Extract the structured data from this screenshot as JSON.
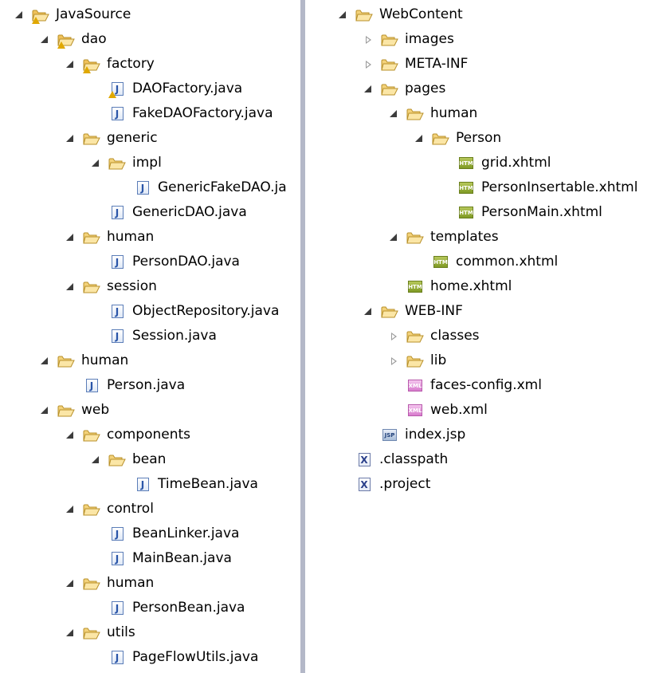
{
  "left_tree": [
    {
      "label": "JavaSource",
      "icon": "package-folder-warning-icon",
      "state": "expanded",
      "depth": 0
    },
    {
      "label": "dao",
      "icon": "package-folder-warning-icon",
      "state": "expanded",
      "depth": 1
    },
    {
      "label": "factory",
      "icon": "package-folder-warning-icon",
      "state": "expanded",
      "depth": 2
    },
    {
      "label": "DAOFactory.java",
      "icon": "java-file-warning-icon",
      "state": "leaf",
      "depth": 3
    },
    {
      "label": "FakeDAOFactory.java",
      "icon": "java-file-icon",
      "state": "leaf",
      "depth": 3
    },
    {
      "label": "generic",
      "icon": "folder-icon",
      "state": "expanded",
      "depth": 2
    },
    {
      "label": "impl",
      "icon": "folder-icon",
      "state": "expanded",
      "depth": 3
    },
    {
      "label": "GenericFakeDAO.ja",
      "icon": "java-file-icon",
      "state": "leaf",
      "depth": 4
    },
    {
      "label": "GenericDAO.java",
      "icon": "java-file-icon",
      "state": "leaf",
      "depth": 3
    },
    {
      "label": "human",
      "icon": "folder-icon",
      "state": "expanded",
      "depth": 2
    },
    {
      "label": "PersonDAO.java",
      "icon": "java-file-icon",
      "state": "leaf",
      "depth": 3
    },
    {
      "label": "session",
      "icon": "folder-icon",
      "state": "expanded",
      "depth": 2
    },
    {
      "label": "ObjectRepository.java",
      "icon": "java-file-icon",
      "state": "leaf",
      "depth": 3
    },
    {
      "label": "Session.java",
      "icon": "java-file-icon",
      "state": "leaf",
      "depth": 3
    },
    {
      "label": "human",
      "icon": "folder-icon",
      "state": "expanded",
      "depth": 1
    },
    {
      "label": "Person.java",
      "icon": "java-file-icon",
      "state": "leaf",
      "depth": 2
    },
    {
      "label": "web",
      "icon": "folder-icon",
      "state": "expanded",
      "depth": 1
    },
    {
      "label": "components",
      "icon": "folder-icon",
      "state": "expanded",
      "depth": 2
    },
    {
      "label": "bean",
      "icon": "folder-icon",
      "state": "expanded",
      "depth": 3
    },
    {
      "label": "TimeBean.java",
      "icon": "java-file-icon",
      "state": "leaf",
      "depth": 4
    },
    {
      "label": "control",
      "icon": "folder-icon",
      "state": "expanded",
      "depth": 2
    },
    {
      "label": "BeanLinker.java",
      "icon": "java-file-icon",
      "state": "leaf",
      "depth": 3
    },
    {
      "label": "MainBean.java",
      "icon": "java-file-icon",
      "state": "leaf",
      "depth": 3
    },
    {
      "label": "human",
      "icon": "folder-icon",
      "state": "expanded",
      "depth": 2
    },
    {
      "label": "PersonBean.java",
      "icon": "java-file-icon",
      "state": "leaf",
      "depth": 3
    },
    {
      "label": "utils",
      "icon": "folder-icon",
      "state": "expanded",
      "depth": 2
    },
    {
      "label": "PageFlowUtils.java",
      "icon": "java-file-icon",
      "state": "leaf",
      "depth": 3
    }
  ],
  "right_tree": [
    {
      "label": "WebContent",
      "icon": "folder-icon",
      "state": "expanded",
      "depth": 0
    },
    {
      "label": "images",
      "icon": "folder-icon",
      "state": "collapsed",
      "depth": 1
    },
    {
      "label": "META-INF",
      "icon": "folder-icon",
      "state": "collapsed",
      "depth": 1
    },
    {
      "label": "pages",
      "icon": "folder-icon",
      "state": "expanded",
      "depth": 1
    },
    {
      "label": "human",
      "icon": "folder-icon",
      "state": "expanded",
      "depth": 2
    },
    {
      "label": "Person",
      "icon": "folder-icon",
      "state": "expanded",
      "depth": 3
    },
    {
      "label": "grid.xhtml",
      "icon": "html-file-icon",
      "state": "leaf",
      "depth": 4
    },
    {
      "label": "PersonInsertable.xhtml",
      "icon": "html-file-icon",
      "state": "leaf",
      "depth": 4
    },
    {
      "label": "PersonMain.xhtml",
      "icon": "html-file-icon",
      "state": "leaf",
      "depth": 4
    },
    {
      "label": "templates",
      "icon": "folder-icon",
      "state": "expanded",
      "depth": 2
    },
    {
      "label": "common.xhtml",
      "icon": "html-file-icon",
      "state": "leaf",
      "depth": 3
    },
    {
      "label": "home.xhtml",
      "icon": "html-file-icon",
      "state": "leaf",
      "depth": 2
    },
    {
      "label": "WEB-INF",
      "icon": "folder-icon",
      "state": "expanded",
      "depth": 1
    },
    {
      "label": "classes",
      "icon": "folder-icon",
      "state": "collapsed",
      "depth": 2
    },
    {
      "label": "lib",
      "icon": "folder-icon",
      "state": "collapsed",
      "depth": 2
    },
    {
      "label": "faces-config.xml",
      "icon": "xml-file-icon",
      "state": "leaf",
      "depth": 2
    },
    {
      "label": "web.xml",
      "icon": "xml-file-icon",
      "state": "leaf",
      "depth": 2
    },
    {
      "label": "index.jsp",
      "icon": "jsp-file-icon",
      "state": "leaf",
      "depth": 1
    },
    {
      "label": ".classpath",
      "icon": "x-file-icon",
      "state": "leaf",
      "depth": 0
    },
    {
      "label": ".project",
      "icon": "x-file-icon",
      "state": "leaf",
      "depth": 0
    }
  ],
  "colors": {
    "folder_fill": "#f3d27a",
    "folder_stroke": "#b8902a",
    "package_fill": "#f0c15a",
    "warning": "#e0a800",
    "divider": "#b4b8c8",
    "background": "#ffffff"
  }
}
